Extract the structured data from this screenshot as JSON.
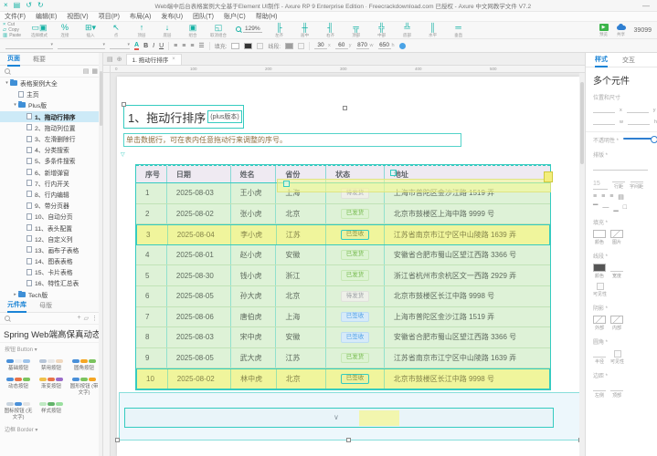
{
  "window": {
    "title": "Web端中后台表格案例大全基于Element UI制作 - Axure RP 9 Enterprise Edition · Freecrackdownload.com 已授权 - Axure 中文网教学文件 V7.2",
    "minimize": "—",
    "counter": "39099"
  },
  "menus": [
    "文件(F)",
    "编辑(E)",
    "视图(V)",
    "项目(P)",
    "布局(A)",
    "发布(U)",
    "团队(T)",
    "账户(C)",
    "帮助(H)"
  ],
  "clipboard": {
    "cut": "Cut",
    "copy": "Copy",
    "paste": "Paste"
  },
  "toolbar": {
    "groups": [
      {
        "icon": "select-mode-icon",
        "glyph": "▭▣",
        "label": "选择模式"
      },
      {
        "icon": "connect-icon",
        "glyph": "%",
        "label": "连接"
      },
      {
        "icon": "insert-icon",
        "glyph": "⊞▾",
        "label": "插入"
      },
      {
        "icon": "point-icon",
        "glyph": "↖",
        "label": "点"
      },
      {
        "icon": "bring-front-icon",
        "glyph": "↑",
        "label": "顶层"
      },
      {
        "icon": "send-back-icon",
        "glyph": "↓",
        "label": "底层"
      },
      {
        "icon": "group-icon",
        "glyph": "▣",
        "label": "组合"
      },
      {
        "icon": "ungroup-icon",
        "glyph": "◱",
        "label": "取消组合"
      },
      {
        "icon": "zoom-icon",
        "glyph": "",
        "label": "129%",
        "is_zoom": true
      },
      {
        "icon": "align-left-icon",
        "glyph": "╟",
        "label": "左齐"
      },
      {
        "icon": "align-center-icon",
        "glyph": "╫",
        "label": "居中"
      },
      {
        "icon": "align-right-icon",
        "glyph": "╢",
        "label": "右齐"
      },
      {
        "icon": "align-top-icon",
        "glyph": "╦",
        "label": "顶部"
      },
      {
        "icon": "align-middle-icon",
        "glyph": "╬",
        "label": "中部"
      },
      {
        "icon": "align-bottom-icon",
        "glyph": "╩",
        "label": "底部"
      },
      {
        "icon": "distribute-h-icon",
        "glyph": "║",
        "label": "水平"
      },
      {
        "icon": "distribute-v-icon",
        "glyph": "═",
        "label": "垂直"
      }
    ],
    "zoom": "129%",
    "preview": "预览",
    "share": "共享"
  },
  "formatbar": {
    "fill_label": "填充:",
    "line_label": "线段:",
    "bold": "B",
    "italic": "I",
    "underline": "U",
    "color_btn": "A",
    "x": "30",
    "y": "60",
    "w": "870",
    "h": "650",
    "unit_x": "x",
    "unit_y": "y",
    "unit_w": "w",
    "unit_h": "h"
  },
  "pages_panel": {
    "tabs": [
      "页面",
      "概要"
    ],
    "tree": [
      {
        "label": "表格案例大全",
        "type": "folder",
        "level": 0,
        "caret": "▾"
      },
      {
        "label": "主页",
        "type": "page",
        "level": 1
      },
      {
        "label": "Plus版",
        "type": "folder",
        "level": 1,
        "caret": "▾"
      },
      {
        "label": "1、拖动行排序",
        "type": "page",
        "level": 2,
        "selected": true
      },
      {
        "label": "2、拖动列位置",
        "type": "page",
        "level": 2
      },
      {
        "label": "3、左滑删除行",
        "type": "page",
        "level": 2
      },
      {
        "label": "4、分类搜索",
        "type": "page",
        "level": 2
      },
      {
        "label": "5、多条件搜索",
        "type": "page",
        "level": 2
      },
      {
        "label": "6、新增弹窗",
        "type": "page",
        "level": 2
      },
      {
        "label": "7、行内开关",
        "type": "page",
        "level": 2
      },
      {
        "label": "8、行内编辑",
        "type": "page",
        "level": 2
      },
      {
        "label": "9、带分页器",
        "type": "page",
        "level": 2
      },
      {
        "label": "10、自动分页",
        "type": "page",
        "level": 2
      },
      {
        "label": "11、表头配置",
        "type": "page",
        "level": 2
      },
      {
        "label": "12、自定义列",
        "type": "page",
        "level": 2
      },
      {
        "label": "13、画布子表格",
        "type": "page",
        "level": 2
      },
      {
        "label": "14、图表表格",
        "type": "page",
        "level": 2
      },
      {
        "label": "15、卡片表格",
        "type": "page",
        "level": 2
      },
      {
        "label": "16、特性汇总表",
        "type": "page",
        "level": 2
      },
      {
        "label": "Tech版",
        "type": "folder",
        "level": 1,
        "caret": "▸"
      }
    ]
  },
  "library_panel": {
    "tabs": [
      "元件库",
      "母版"
    ],
    "title": "Spring Web端高保真动态交",
    "button_section": "按钮 Button",
    "border_section": "边框 Border",
    "items": [
      {
        "label": "基础按钮",
        "colors": [
          "#4a90d9",
          "#e8eef5",
          "#9ec3ea"
        ]
      },
      {
        "label": "禁用按钮",
        "colors": [
          "#b8c6d8",
          "#e8e8e8",
          "#f0d8be"
        ]
      },
      {
        "label": "圆角按钮",
        "colors": [
          "#4a90d9",
          "#f5a623",
          "#7bc35e"
        ]
      },
      {
        "label": "动态按钮",
        "colors": [
          "#4a90d9",
          "#e8744a",
          "#7bc35e"
        ]
      },
      {
        "label": "渐变按钮",
        "colors": [
          "#f0c14b",
          "#e8744a",
          "#9b6bc9"
        ]
      },
      {
        "label": "圆形按钮 (带文字)",
        "colors": [
          "#4a90d9",
          "#7bc35e",
          "#f5a623"
        ]
      },
      {
        "label": "图标按钮 (无文字)",
        "colors": [
          "#c9d4de",
          "#4a90d9",
          "#e4e4e4"
        ]
      },
      {
        "label": "样式按钮",
        "colors": [
          "#bfe9c3",
          "#62b36a",
          "#9adf9f"
        ]
      }
    ]
  },
  "canvas": {
    "tab": "1. 拖动行排序",
    "ruler": [
      "0",
      "100",
      "200",
      "300",
      "400",
      "500"
    ],
    "title": "1、拖动行排序",
    "title_suffix": "(plus版本)",
    "subtitle": "单击数据行，可在表内任意拖动行来调整的序号。",
    "collapse_mark": "▽",
    "footer_chevron": "∨"
  },
  "table": {
    "headers": [
      "序号",
      "日期",
      "姓名",
      "省份",
      "状态",
      "地址"
    ],
    "rows": [
      {
        "seq": "1",
        "date": "2025-08-03",
        "name": "王小虎",
        "province": "上海",
        "status": "待发货",
        "status_type": "info",
        "address": "上海市普陀区金沙江路 1519 弄",
        "highlight": false
      },
      {
        "seq": "2",
        "date": "2025-08-02",
        "name": "张小虎",
        "province": "北京",
        "status": "已发货",
        "status_type": "success",
        "address": "北京市鼓楼区上海中路 9999 号",
        "highlight": false
      },
      {
        "seq": "3",
        "date": "2025-08-04",
        "name": "李小虎",
        "province": "江苏",
        "status": "已签收",
        "status_type": "success",
        "address": "江苏省南京市江宁区中山陵路 1639 弄",
        "highlight": true
      },
      {
        "seq": "4",
        "date": "2025-08-01",
        "name": "赵小虎",
        "province": "安徽",
        "status": "已发货",
        "status_type": "success",
        "address": "安徽省合肥市蜀山区望江西路 3366 号",
        "highlight": false
      },
      {
        "seq": "5",
        "date": "2025-08-30",
        "name": "钱小虎",
        "province": "浙江",
        "status": "已发货",
        "status_type": "success",
        "address": "浙江省杭州市余杭区文一西路 2929 弄",
        "highlight": false
      },
      {
        "seq": "6",
        "date": "2025-08-05",
        "name": "孙大虎",
        "province": "北京",
        "status": "待发货",
        "status_type": "info",
        "address": "北京市鼓楼区长江中路 9998 号",
        "highlight": false
      },
      {
        "seq": "7",
        "date": "2025-08-06",
        "name": "唐伯虎",
        "province": "上海",
        "status": "已签收",
        "status_type": "primary",
        "address": "上海市普陀区金沙江路 1519 弄",
        "highlight": false
      },
      {
        "seq": "8",
        "date": "2025-08-03",
        "name": "宋中虎",
        "province": "安徽",
        "status": "已签收",
        "status_type": "primary",
        "address": "安徽省合肥市蜀山区望江西路 3366 号",
        "highlight": false
      },
      {
        "seq": "9",
        "date": "2025-08-05",
        "name": "武大虎",
        "province": "江苏",
        "status": "已发货",
        "status_type": "success",
        "address": "江苏省南京市江宁区中山陵路 1639 弄",
        "highlight": false
      },
      {
        "seq": "10",
        "date": "2025-08-02",
        "name": "林中虎",
        "province": "北京",
        "status": "已签收",
        "status_type": "success",
        "address": "北京市鼓楼区长江中路 9998 号",
        "highlight": true
      }
    ]
  },
  "style_panel": {
    "tabs": [
      "样式",
      "交互"
    ],
    "heading": "多个元件",
    "position_label": "位置和尺寸",
    "unit_x": "x",
    "unit_y": "y",
    "unit_w": "w",
    "unit_h": "h",
    "opacity_label": "不透明性 *",
    "type_label": "排版 *",
    "font_size": "15",
    "line_height_label": "行距",
    "letter_spacing_label": "字间距",
    "fill_label": "填充 *",
    "color_label": "颜色",
    "image_label": "图片",
    "line_label": "线段 *",
    "width_label": "宽度",
    "visible_label": "可见性",
    "shadow_label": "阴影 *",
    "outer_label": "外部",
    "inner_label": "内部",
    "radius_label": "圆角 *",
    "radius_value_label": "半径",
    "margin_label": "边距 *",
    "left_label": "左侧",
    "top_label": "顶部"
  },
  "colors": {
    "accent": "#14b1a4",
    "selection": "#35cbc0",
    "row_green": "#def2d7",
    "row_yellow": "#f0f59c",
    "header_bg": "#efeaf2",
    "tab_blue": "#1b84d6"
  }
}
